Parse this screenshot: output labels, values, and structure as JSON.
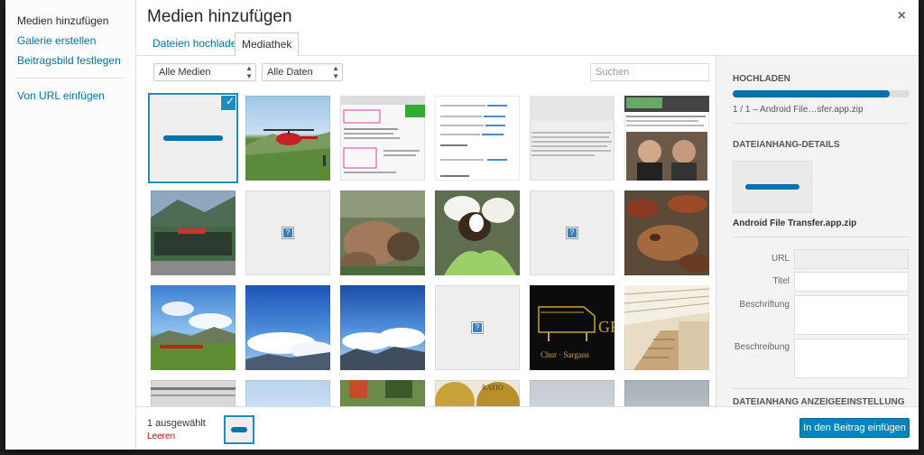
{
  "menu": {
    "items": [
      {
        "label": "Medien hinzufügen"
      },
      {
        "label": "Galerie erstellen"
      },
      {
        "label": "Beitragsbild festlegen"
      },
      {
        "label": "Von URL einfügen"
      }
    ]
  },
  "header": {
    "title": "Medien hinzufügen",
    "close": "×"
  },
  "tabs": [
    {
      "label": "Dateien hochladen"
    },
    {
      "label": "Mediathek"
    }
  ],
  "toolbar": {
    "filter_media": "Alle Medien",
    "filter_dates": "Alle Daten",
    "search_placeholder": "Suchen"
  },
  "sidebar": {
    "upload_heading": "HOCHLADEN",
    "upload_progress": 0.89,
    "upload_status": "1 / 1  –  Android File…sfer.app.zip",
    "details_heading": "DATEIANHANG-DETAILS",
    "filename": "Android File Transfer.app.zip",
    "fields": {
      "url": "URL",
      "title": "Titel",
      "caption": "Beschriftung",
      "description": "Beschreibung"
    },
    "display_heading": "DATEIANHANG ANZEIGEEINSTELLUNG"
  },
  "footer": {
    "count": "1 ausgewählt",
    "clear": "Leeren",
    "insert": "In den Beitrag einfügen"
  },
  "thumbnail_labels": {
    "piano_text": "GR",
    "piano_sub": "Chur · Sargans",
    "coin_text": "RATIO"
  },
  "colors": {
    "accent": "#0073aa",
    "selection": "#1e8cbe",
    "clear_link": "#cc0000"
  }
}
